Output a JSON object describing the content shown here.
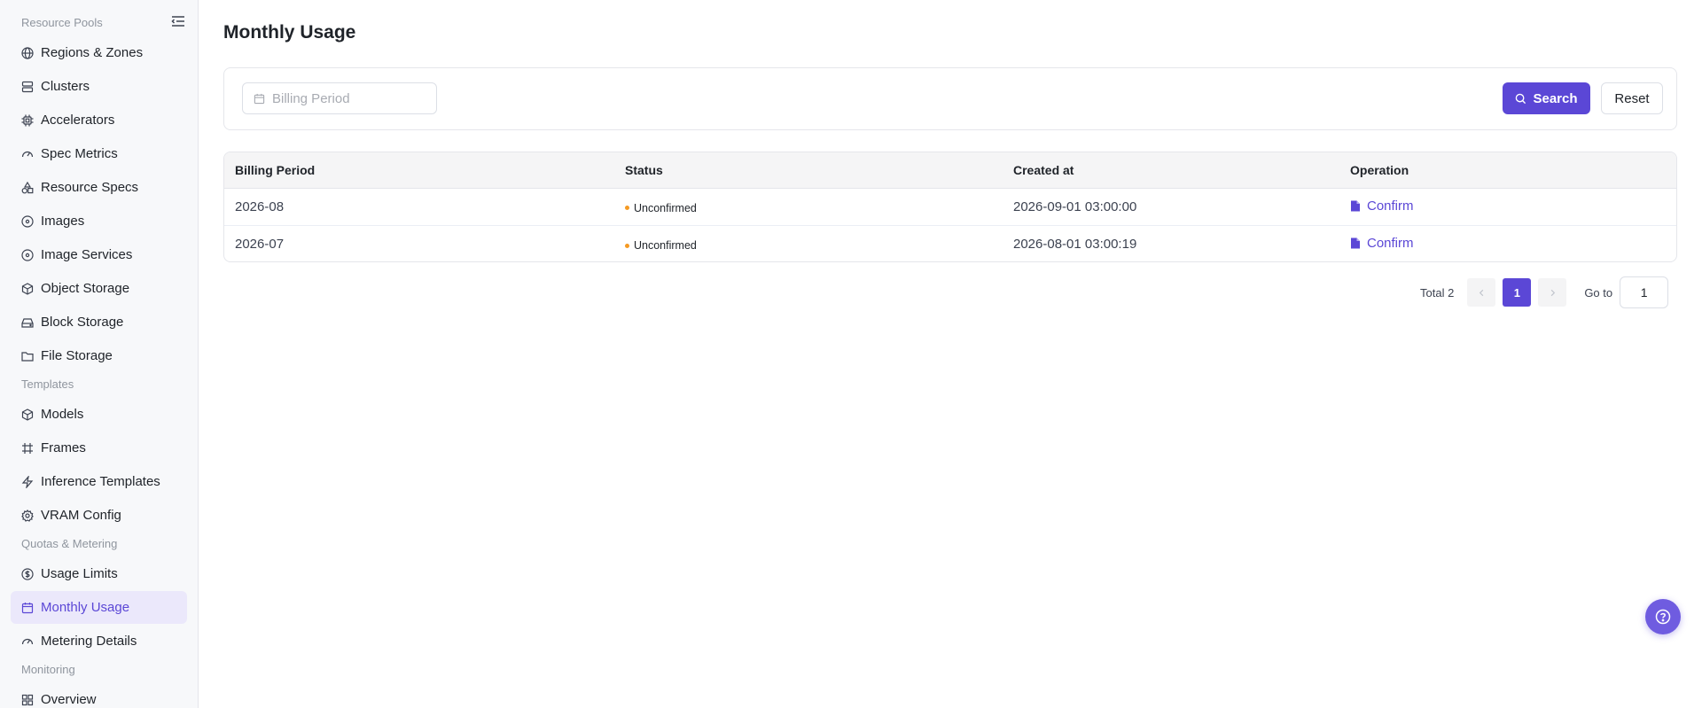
{
  "sidebar": {
    "groups": {
      "resource_pools": "Resource Pools",
      "templates": "Templates",
      "quotas": "Quotas & Metering",
      "monitoring": "Monitoring"
    },
    "items": {
      "regions": "Regions & Zones",
      "clusters": "Clusters",
      "accelerators": "Accelerators",
      "spec_metrics": "Spec Metrics",
      "resource_specs": "Resource Specs",
      "images": "Images",
      "image_services": "Image Services",
      "object_storage": "Object Storage",
      "block_storage": "Block Storage",
      "file_storage": "File Storage",
      "models": "Models",
      "frames": "Frames",
      "inference_templates": "Inference Templates",
      "vram_config": "VRAM Config",
      "usage_limits": "Usage Limits",
      "monthly_usage": "Monthly Usage",
      "metering_details": "Metering Details",
      "overview": "Overview"
    },
    "active_item": "monthly_usage"
  },
  "page": {
    "title": "Monthly Usage"
  },
  "filter": {
    "billing_period_placeholder": "Billing Period",
    "search_label": "Search",
    "reset_label": "Reset"
  },
  "table": {
    "headers": {
      "billing_period": "Billing Period",
      "status": "Status",
      "created_at": "Created at",
      "operation": "Operation"
    },
    "rows": [
      {
        "billing_period": "2026-08",
        "status": "Unconfirmed",
        "created_at": "2026-09-01 03:00:00",
        "operation": "Confirm"
      },
      {
        "billing_period": "2026-07",
        "status": "Unconfirmed",
        "created_at": "2026-08-01 03:00:19",
        "operation": "Confirm"
      }
    ]
  },
  "pagination": {
    "total_label": "Total 2",
    "current_page": "1",
    "goto_label": "Go to",
    "goto_value": "1"
  },
  "colors": {
    "accent": "#5b47d6",
    "status_unconfirmed": "#f59a23",
    "active_nav_bg": "#ebe8fb"
  }
}
